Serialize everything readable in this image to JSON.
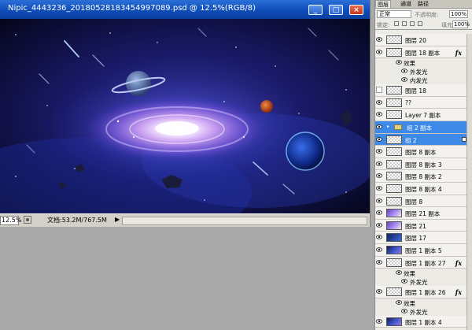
{
  "window": {
    "title": "Nipic_4443236_20180528183454997089.psd @ 12.5%(RGB/8)",
    "buttons": {
      "minimize": "_",
      "restore": "□",
      "close": "×"
    }
  },
  "status": {
    "zoom": "12.5%",
    "doc_size": "文档:53.2M/767.5M",
    "arrow": "▶"
  },
  "panel": {
    "tabs": [
      "图层",
      "通道",
      "路径"
    ],
    "blend_mode": "正常",
    "opacity_label": "不透明度:",
    "opacity_value": "100%",
    "lock_label": "锁定:",
    "fill_label": "填充:",
    "fill_value": "100%"
  },
  "layers": [
    {
      "name": "图层 20",
      "kind": "layer",
      "thumb": "checker",
      "visible": true
    },
    {
      "name": "图层 18 副本",
      "kind": "layer",
      "thumb": "checker",
      "visible": true,
      "fx": "fx"
    },
    {
      "name": "效果",
      "kind": "effect"
    },
    {
      "name": "外发光",
      "kind": "effect-item"
    },
    {
      "name": "内发光",
      "kind": "effect-item"
    },
    {
      "name": "图层 18",
      "kind": "layer",
      "thumb": "checker",
      "visible": false
    },
    {
      "name": "??",
      "kind": "layer",
      "thumb": "checker",
      "visible": true
    },
    {
      "name": "Layer 7 副本",
      "kind": "layer",
      "thumb": "checker",
      "visible": true
    },
    {
      "name": "组 2 副本",
      "kind": "group",
      "visible": true,
      "selected": true
    },
    {
      "name": "组 2",
      "kind": "layer",
      "thumb": "checker",
      "visible": true,
      "selected": true,
      "locked": true
    },
    {
      "name": "图层 8 副本",
      "kind": "layer",
      "thumb": "checker",
      "visible": true
    },
    {
      "name": "图层 8 副本 3",
      "kind": "layer",
      "thumb": "checker",
      "visible": true
    },
    {
      "name": "图层 8 副本 2",
      "kind": "layer",
      "thumb": "checker",
      "visible": true
    },
    {
      "name": "图层 8 副本 4",
      "kind": "layer",
      "thumb": "checker",
      "visible": true
    },
    {
      "name": "图层 8",
      "kind": "layer",
      "thumb": "checker",
      "visible": true
    },
    {
      "name": "图层 21 副本",
      "kind": "layer",
      "thumb": "purple",
      "visible": true
    },
    {
      "name": "图层 21",
      "kind": "layer",
      "thumb": "purple",
      "visible": true
    },
    {
      "name": "图层 17",
      "kind": "layer",
      "thumb": "blue",
      "visible": true
    },
    {
      "name": "图层 1 副本 5",
      "kind": "layer",
      "thumb": "dark",
      "visible": true
    },
    {
      "name": "图层 1 副本 27",
      "kind": "layer",
      "thumb": "checker",
      "visible": true,
      "fx": "fx"
    },
    {
      "name": "效果",
      "kind": "effect"
    },
    {
      "name": "外发光",
      "kind": "effect-item"
    },
    {
      "name": "图层 1 副本 26",
      "kind": "layer",
      "thumb": "checker",
      "visible": true,
      "fx": "fx"
    },
    {
      "name": "效果",
      "kind": "effect"
    },
    {
      "name": "外发光",
      "kind": "effect-item"
    },
    {
      "name": "图层 1 副本 4",
      "kind": "layer",
      "thumb": "dark",
      "visible": true
    }
  ]
}
